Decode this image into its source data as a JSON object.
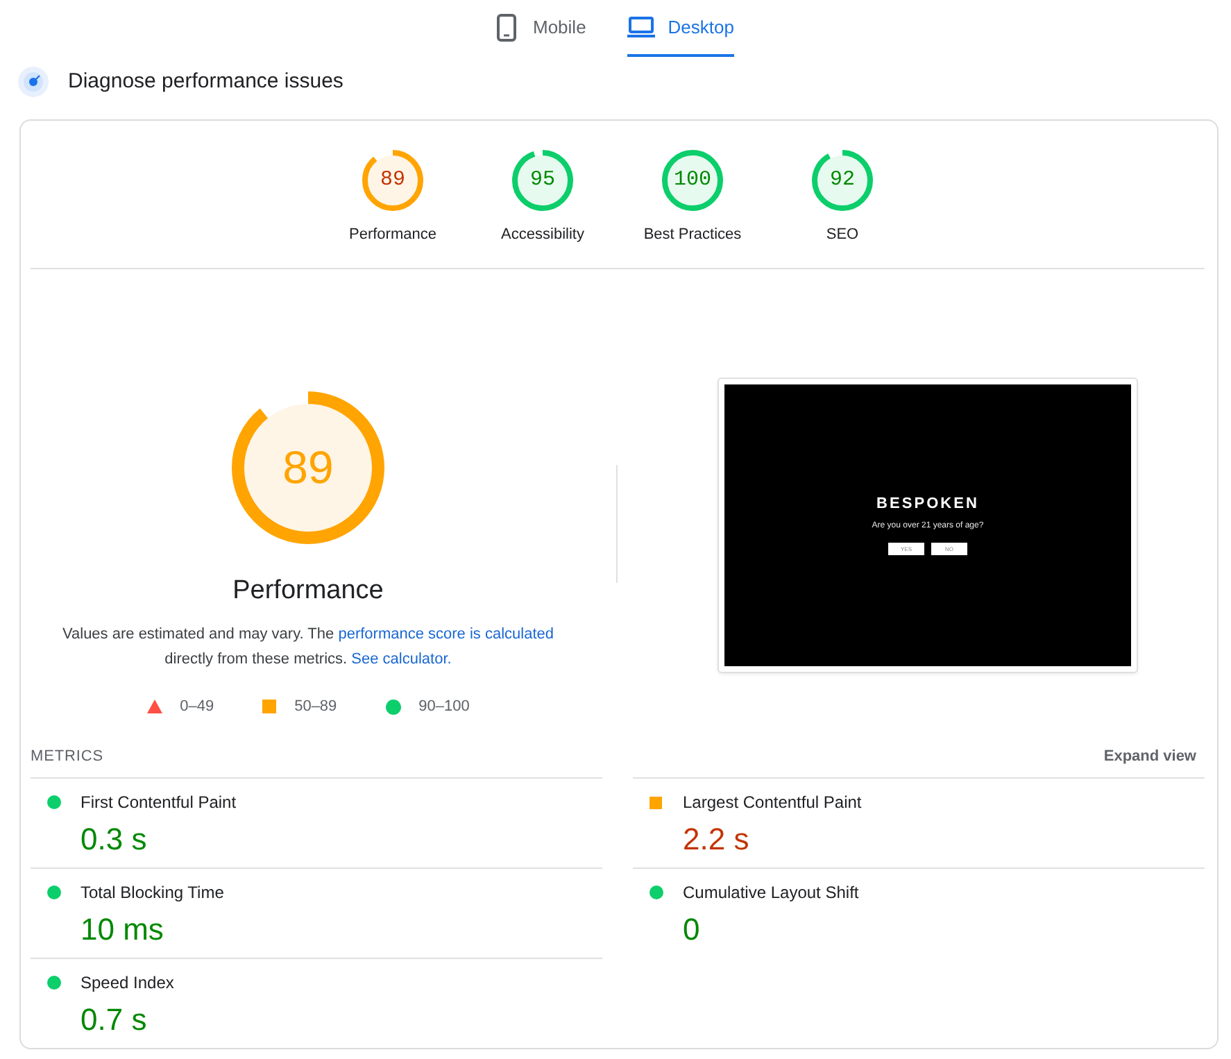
{
  "device_tabs": [
    {
      "label": "Mobile",
      "kind": "phone",
      "selected": false
    },
    {
      "label": "Desktop",
      "kind": "laptop",
      "selected": true
    }
  ],
  "section_title": "Diagnose performance issues",
  "category_gauges": [
    {
      "label": "Performance",
      "score": "89",
      "level": 0.89,
      "kind": "average"
    },
    {
      "label": "Accessibility",
      "score": "95",
      "level": 0.95,
      "kind": "pass"
    },
    {
      "label": "Best Practices",
      "score": "100",
      "level": 1,
      "kind": "pass"
    },
    {
      "label": "SEO",
      "score": "92",
      "level": 0.92,
      "kind": "pass"
    }
  ],
  "performance": {
    "score": "89",
    "level": 0.89,
    "kind": "average",
    "title": "Performance",
    "description": [
      {
        "kind": "text",
        "text": "Values are estimated and may vary. The "
      },
      {
        "kind": "link",
        "text": "performance score is calculated"
      },
      {
        "kind": "text",
        "text": " directly from these metrics. "
      },
      {
        "kind": "link",
        "text": "See calculator."
      }
    ],
    "legend": [
      {
        "kind": "fail",
        "label": "0–49"
      },
      {
        "kind": "average",
        "label": "50–89"
      },
      {
        "kind": "pass",
        "label": "90–100"
      }
    ]
  },
  "page_screenshot": {
    "brand": "BESPOKEN",
    "question": "Are you over 21 years of age?",
    "buttons": [
      "YES",
      "NO"
    ]
  },
  "metrics": {
    "title": "METRICS",
    "toggle": "Expand view",
    "items": [
      {
        "label": "First Contentful Paint",
        "value": "0.3 s",
        "kind": "pass"
      },
      {
        "label": "Largest Contentful Paint",
        "value": "2.2 s",
        "kind": "average"
      },
      {
        "label": "Total Blocking Time",
        "value": "10 ms",
        "kind": "pass"
      },
      {
        "label": "Cumulative Layout Shift",
        "value": "0",
        "kind": "pass"
      },
      {
        "label": "Speed Index",
        "value": "0.7 s",
        "kind": "pass"
      }
    ]
  }
}
